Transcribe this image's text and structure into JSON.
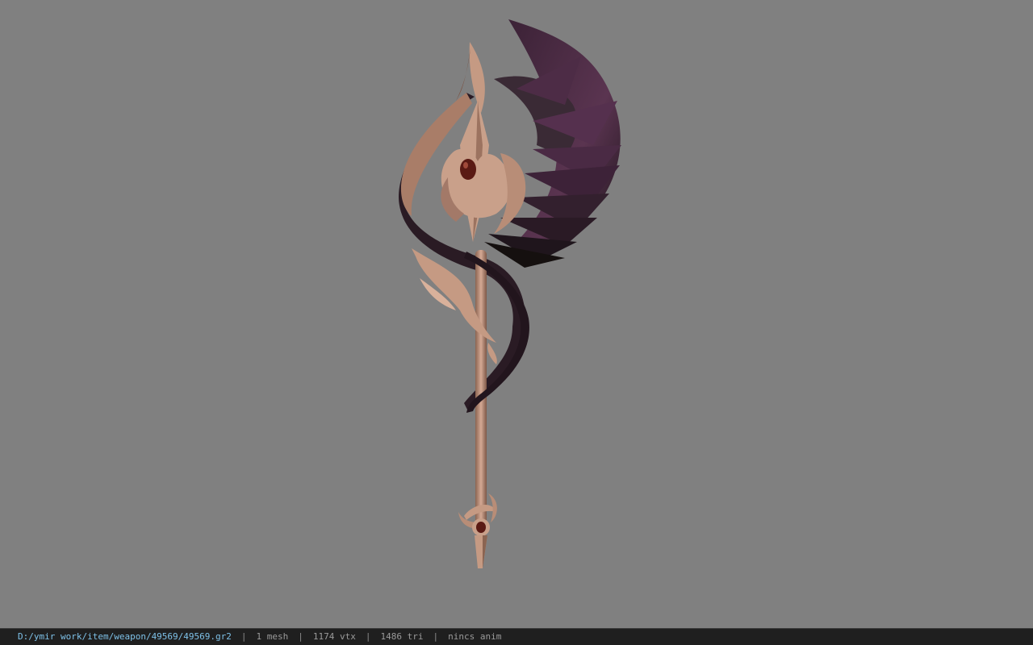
{
  "viewport": {
    "background": "#808080",
    "model": "staff-weapon-model",
    "colors": {
      "metal": "#c59a83",
      "metal_dark": "#8b6451",
      "ribbon": "#2a1b24",
      "feather": "#4a2a45",
      "gem": "#5a1a14"
    }
  },
  "statusbar": {
    "file_path": "D:/ymir work/item/weapon/49569/49569.gr2",
    "separator": "|",
    "mesh_count": "1 mesh",
    "vertex_count": "1174 vtx",
    "triangle_count": "1486 tri",
    "anim_status": "nincs anim"
  }
}
